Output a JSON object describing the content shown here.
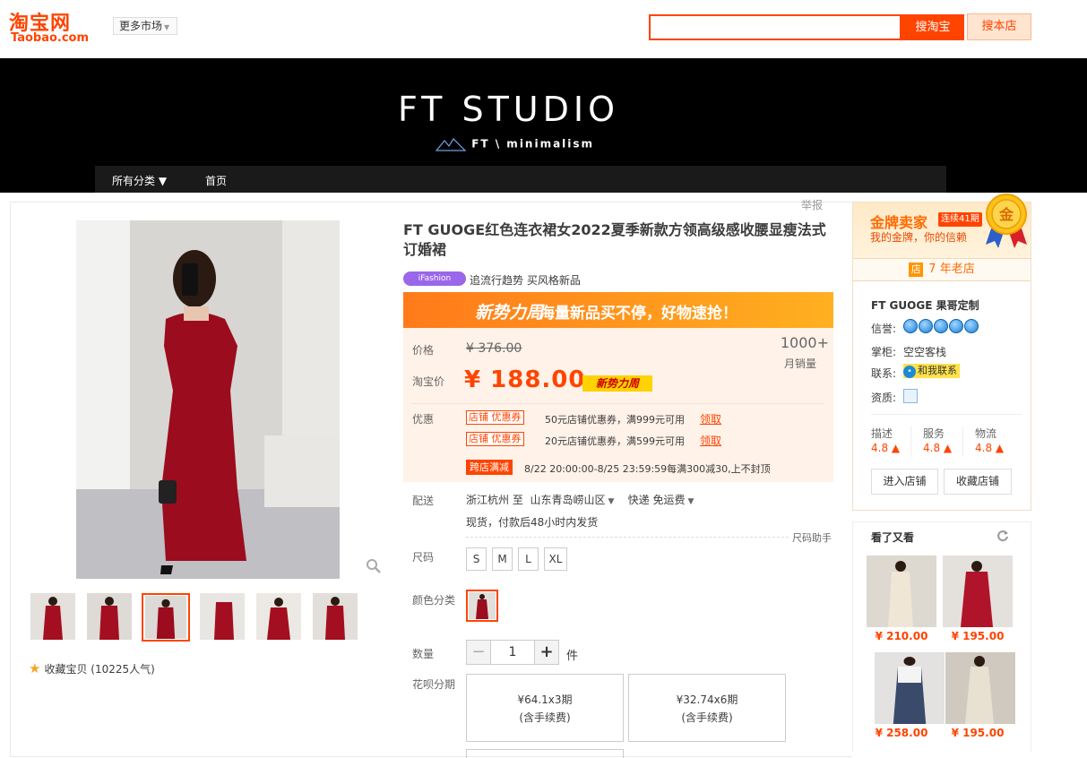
{
  "top": {
    "logo_cn": "淘宝网",
    "logo_en": "Taobao.com",
    "market_label": "更多市场",
    "search_value": "",
    "btn_taobao": "搜淘宝",
    "btn_shop": "搜本店"
  },
  "banner": {
    "brand": "FT  STUDIO",
    "brand_sub": "FT \\ minimalism",
    "nav": [
      "所有分类",
      "首页"
    ]
  },
  "report": "举报",
  "favorite": "收藏宝贝 (10225人气)",
  "product": {
    "title": "FT GUOGE红色连衣裙女2022夏季新款方领高级感收腰显瘦法式订婚裙",
    "ifashion_badge": "iFashion",
    "ifashion_text": "追流行趋势 买风格新品",
    "promo_logo": "新势力周",
    "promo_text": "海量新品买不停，好物速抢！",
    "price_label": "价格",
    "old_price": "¥ 376.00",
    "sales_count": "1000+",
    "sales_label": "月销量",
    "tb_price_label": "淘宝价",
    "price": "¥ 188.00",
    "price_tag": "新势力周",
    "coupon_label": "优惠",
    "coupons": [
      {
        "badge": "店铺 优惠券",
        "text": "50元店铺优惠券，满999元可用",
        "link": "领取"
      },
      {
        "badge": "店铺 优惠券",
        "text": "20元店铺优惠券，满599元可用",
        "link": "领取"
      }
    ],
    "cross_badge": "跨店满减",
    "cross_text": "8/22 20:00:00-8/25 23:59:59每满300减30,上不封顶",
    "delivery_label": "配送",
    "delivery_from": "浙江杭州 至",
    "delivery_to": "山东青岛崂山区",
    "delivery_method": "快递 免运费",
    "delivery_note": "现货，付款后48小时内发货",
    "size_helper": "尺码助手",
    "size_label": "尺码",
    "sizes": [
      "S",
      "M",
      "L",
      "XL"
    ],
    "color_label": "颜色分类",
    "qty_label": "数量",
    "qty": "1",
    "qty_minus": "−",
    "qty_plus": "+",
    "qty_unit": "件",
    "installment_label": "花呗分期",
    "installments": [
      {
        "amount": "¥64.1x3期",
        "fee": "(含手续费)"
      },
      {
        "amount": "¥32.74x6期",
        "fee": "(含手续费)"
      }
    ]
  },
  "shop": {
    "gold_title": "金牌卖家",
    "gold_badge": "连续41期",
    "gold_sub": "我的金牌，你的信赖",
    "medal": "金",
    "years": "7 年老店",
    "years_icon": "店",
    "name": "FT GUOGE 果哥定制",
    "credit_label": "信誉:",
    "credit_crowns": 5,
    "keeper_label": "掌柜:",
    "keeper": "空空客栈",
    "contact_label": "联系:",
    "contact": "和我联系",
    "qual_label": "资质:",
    "scores": [
      {
        "label": "描述",
        "value": "4.8"
      },
      {
        "label": "服务",
        "value": "4.8"
      },
      {
        "label": "物流",
        "value": "4.8"
      }
    ],
    "enter_btn": "进入店铺",
    "collect_btn": "收藏店铺"
  },
  "recommend": {
    "title": "看了又看",
    "items": [
      {
        "price": "¥ 210.00",
        "color": "#efe6d6"
      },
      {
        "price": "¥ 195.00",
        "color": "#b0142a"
      },
      {
        "price": "¥ 258.00",
        "color": "#3a4a6a"
      },
      {
        "price": "¥ 195.00",
        "color": "#e8e0d0"
      }
    ]
  }
}
